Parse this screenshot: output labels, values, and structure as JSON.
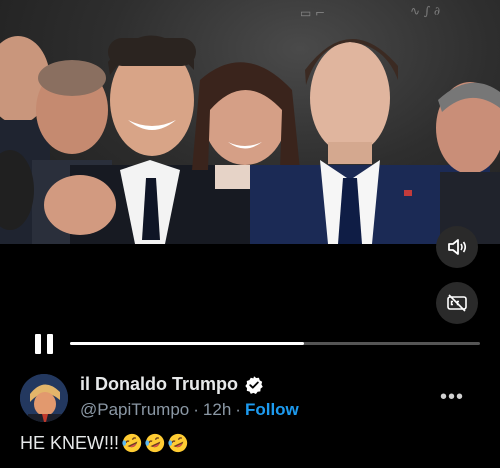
{
  "video": {
    "mute_icon": "speaker-icon",
    "cc_icon": "captions-off-icon",
    "progress": 0.57
  },
  "post": {
    "display_name": "il Donaldo Trumpo",
    "handle": "@PapiTrumpo",
    "separator1": "·",
    "time": "12h",
    "separator2": "·",
    "follow_label": "Follow",
    "more_label": "•••",
    "text": "HE KNEW!!!",
    "emoji_count": 3,
    "emoji_icon": "rolling-on-floor-laughing-emoji"
  },
  "colors": {
    "background": "#000000",
    "link": "#1d9bf0",
    "verified": "#ffffff"
  }
}
